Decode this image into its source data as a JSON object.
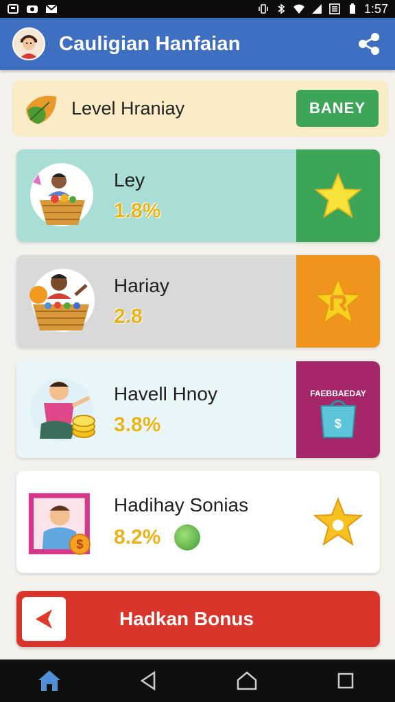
{
  "status_bar": {
    "time": "1:57",
    "left_icons": [
      "storage-icon",
      "camera-icon",
      "mail-icon"
    ],
    "right_icons": [
      "vibrate-icon",
      "bluetooth-icon",
      "wifi-icon",
      "signal-icon",
      "data-icon",
      "battery-icon"
    ]
  },
  "app_bar": {
    "title": "Cauligian Hanfaian",
    "avatar_icon": "avatar",
    "action_icon": "share-icon"
  },
  "level_banner": {
    "label": "Level Hraniay",
    "button_label": "BANEY",
    "icon": "leaf-icon"
  },
  "cards": [
    {
      "title": "Ley",
      "value": "1.8%",
      "side_icon": "star-icon"
    },
    {
      "title": "Hariay",
      "value": "2.8",
      "side_icon": "star-badge-icon"
    },
    {
      "title": "Havell Hnoy",
      "value": "3.8%",
      "side_icon": "gift-bag-icon",
      "side_text": "FAEBBAEDAY"
    },
    {
      "title": "Hadihay Sonias",
      "value": "8.2%",
      "side_icon": "star-icon",
      "extra_icon": "green-coin-icon"
    }
  ],
  "bonus": {
    "label": "Hadkan Bonus",
    "icon": "back-arrow-icon"
  },
  "nav_bar": {
    "items": [
      "home-icon",
      "back-icon",
      "home-circle-icon",
      "recent-apps-icon"
    ]
  },
  "colors": {
    "app_bar": "#3f6fc0",
    "level_banner_bg": "#fbecc8",
    "level_button": "#3ca558",
    "card1_bg": "#a8ded6",
    "card1_side": "#3ca558",
    "card2_bg": "#d9d9d9",
    "card2_side": "#f0941e",
    "card3_bg": "#e8f5f9",
    "card3_side": "#a5276a",
    "card4_bg": "#ffffff",
    "bonus_bg": "#d9352b",
    "value_gold": "#e9b419"
  }
}
